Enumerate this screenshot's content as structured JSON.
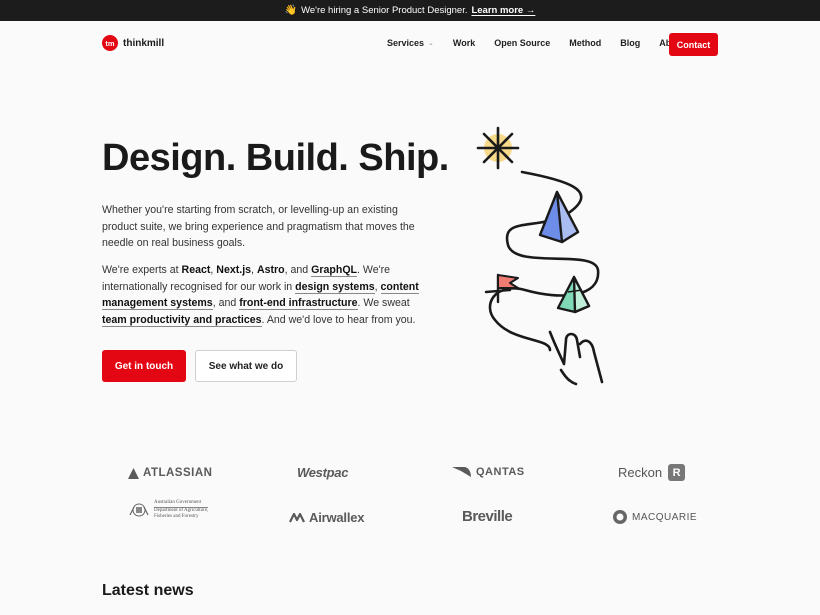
{
  "announcement": {
    "emoji": "👋",
    "text": "We're hiring a Senior Product Designer.",
    "link": "Learn more →"
  },
  "header": {
    "logo_mark": "tm",
    "logo_text": "thinkmill",
    "nav": [
      "Services",
      "Work",
      "Open Source",
      "Method",
      "Blog",
      "About"
    ],
    "services_chevron": "⌄",
    "contact_label": "Contact"
  },
  "hero": {
    "title": "Design. Build. Ship.",
    "intro": "Whether you're starting from scratch, or levelling-up an existing product suite, we bring experience and pragmatism that moves the needle on real business goals.",
    "expert_parts": {
      "p1": "We're experts at ",
      "react": "React",
      "comma1": ", ",
      "next": "Next.js",
      "comma2": ", ",
      "astro": "Astro",
      "and1": ", and ",
      "graphql": "GraphQL",
      "p2": ". We're internationally recognised for our work in ",
      "ds": "design systems",
      "comma3": ", ",
      "cms": "content management systems",
      "and2": ", and ",
      "fei": "front-end infrastructure",
      "p3": ". We sweat ",
      "tpp": "team productivity and practices",
      "p4": ". And we'd love to hear from you."
    },
    "cta_primary": "Get in touch",
    "cta_secondary": "See what we do"
  },
  "clients": {
    "atlassian": "ATLASSIAN",
    "westpac": "Westpac",
    "qantas": "QANTAS",
    "reckon": "Reckon",
    "reckon_mark": "R",
    "gov_line1": "Australian Government",
    "gov_line2": "Department of Agriculture,",
    "gov_line3": "Fisheries and Forestry",
    "airwallex": "Airwallex",
    "breville": "Breville",
    "macquarie": "MACQUARIE"
  },
  "latest_news": "Latest news",
  "colors": {
    "brand_red": "#e30613",
    "dark_bar": "#1c1c1c",
    "background": "#fafafa"
  }
}
